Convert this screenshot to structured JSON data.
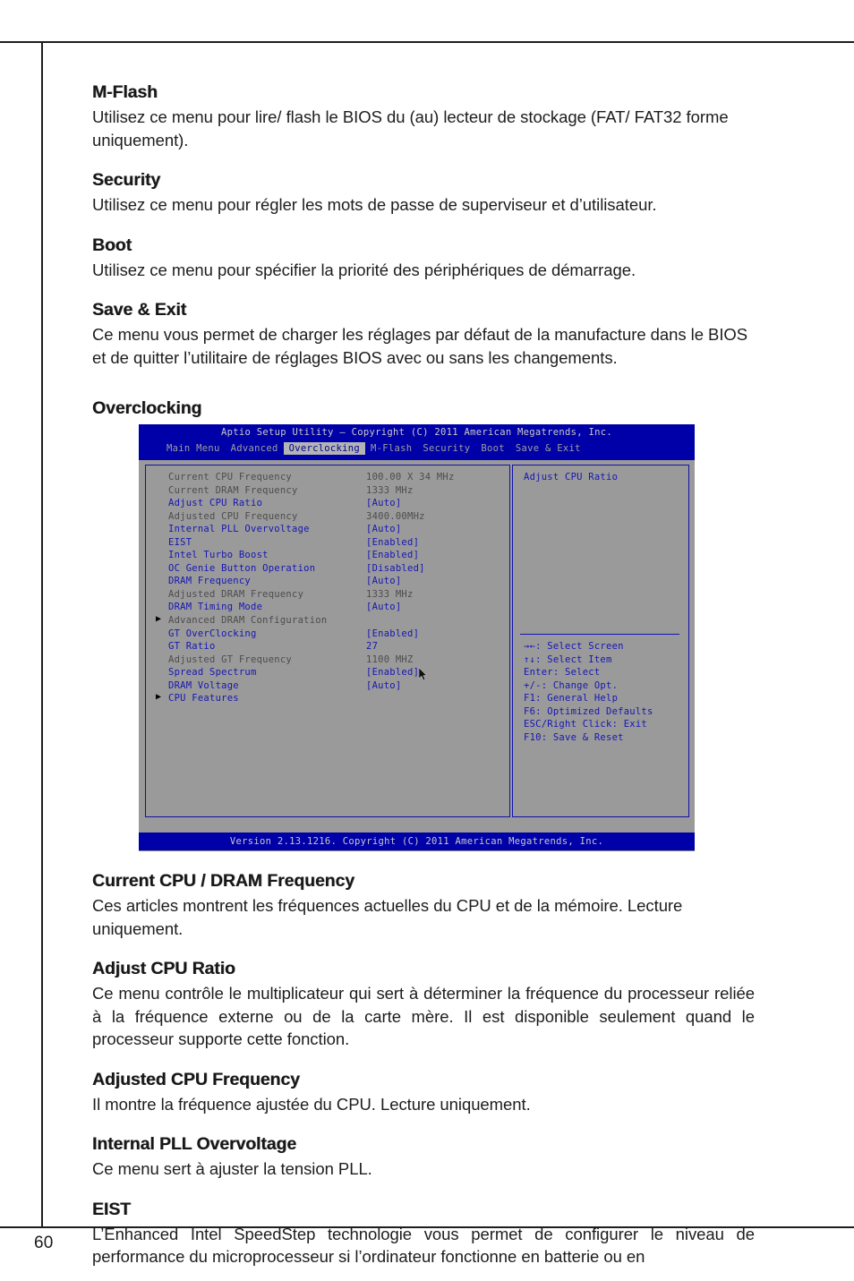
{
  "page": {
    "number": "60"
  },
  "sections": [
    {
      "title": "M-Flash",
      "body": "Utilisez ce menu pour lire/ flash le BIOS du (au) lecteur de stockage (FAT/ FAT32 forme uniquement)."
    },
    {
      "title": "Security",
      "body": "Utilisez ce menu pour régler les mots de passe de superviseur et d’utilisateur."
    },
    {
      "title": "Boot",
      "body": "Utilisez ce menu pour spécifier la priorité des périphériques de démarrage."
    },
    {
      "title": "Save & Exit",
      "body": "Ce menu vous permet de charger les réglages par défaut de la manufacture dans le BIOS et de quitter l’utilitaire de réglages BIOS avec ou sans les changements."
    }
  ],
  "overclocking_heading": "Overclocking",
  "bios": {
    "title": "Aptio Setup Utility – Copyright (C) 2011 American Megatrends, Inc.",
    "menu": [
      {
        "label": "Main Menu",
        "active": false
      },
      {
        "label": "Advanced",
        "active": false
      },
      {
        "label": "Overclocking",
        "active": true
      },
      {
        "label": "M-Flash",
        "active": false
      },
      {
        "label": "Security",
        "active": false
      },
      {
        "label": "Boot",
        "active": false
      },
      {
        "label": "Save & Exit",
        "active": false
      }
    ],
    "rows": [
      {
        "label": "Current CPU Frequency",
        "value": "100.00 X 34 MHz",
        "style": "grey",
        "arrow": ""
      },
      {
        "label": "Current DRAM Frequency",
        "value": "1333 MHz",
        "style": "grey",
        "arrow": ""
      },
      {
        "label": "Adjust CPU Ratio",
        "value": "[Auto]",
        "style": "blue",
        "arrow": ""
      },
      {
        "label": "Adjusted CPU Frequency",
        "value": "3400.00MHz",
        "style": "grey",
        "arrow": ""
      },
      {
        "label": "Internal PLL Overvoltage",
        "value": "[Auto]",
        "style": "blue",
        "arrow": ""
      },
      {
        "label": "EIST",
        "value": "[Enabled]",
        "style": "blue",
        "arrow": ""
      },
      {
        "label": "Intel Turbo Boost",
        "value": "[Enabled]",
        "style": "blue",
        "arrow": ""
      },
      {
        "label": "OC Genie Button Operation",
        "value": "[Disabled]",
        "style": "blue",
        "arrow": ""
      },
      {
        "label": "DRAM Frequency",
        "value": "[Auto]",
        "style": "blue",
        "arrow": ""
      },
      {
        "label": "Adjusted DRAM Frequency",
        "value": "1333 MHz",
        "style": "grey",
        "arrow": ""
      },
      {
        "label": "DRAM Timing Mode",
        "value": "[Auto]",
        "style": "blue",
        "arrow": ""
      },
      {
        "label": "Advanced DRAM Configuration",
        "value": "",
        "style": "grey",
        "arrow": "▶"
      },
      {
        "label": "GT OverClocking",
        "value": "[Enabled]",
        "style": "blue",
        "arrow": ""
      },
      {
        "label": "GT Ratio",
        "value": "27",
        "style": "blue",
        "arrow": ""
      },
      {
        "label": "Adjusted GT Frequency",
        "value": "1100 MHZ",
        "style": "grey",
        "arrow": ""
      },
      {
        "label": "Spread Spectrum",
        "value": "[Enabled]",
        "style": "blue",
        "arrow": ""
      },
      {
        "label": "DRAM Voltage",
        "value": "[Auto]",
        "style": "blue",
        "arrow": ""
      },
      {
        "label": "CPU Features",
        "value": "",
        "style": "blue",
        "arrow": "▶"
      }
    ],
    "help": {
      "title": "Adjust CPU Ratio",
      "keys": [
        "→←: Select Screen",
        "↑↓: Select Item",
        "Enter: Select",
        "+/-: Change Opt.",
        "F1: General Help",
        "F6: Optimized Defaults",
        "ESC/Right Click: Exit",
        "F10: Save & Reset"
      ]
    },
    "footer": "Version 2.13.1216. Copyright (C) 2011 American Megatrends, Inc.",
    "colors": {
      "header_blue": "#0000a8",
      "body_grey": "#9a9a9a",
      "text_blue": "#1616b4",
      "text_grey": "#4d4d4d",
      "active_tab_bg": "#b4b4b4"
    }
  },
  "sections_after": [
    {
      "title": "Current CPU / DRAM Frequency",
      "body": "Ces articles montrent les fréquences actuelles du CPU et de la mémoire. Lecture uniquement."
    },
    {
      "title": "Adjust CPU Ratio",
      "body": "Ce menu contrôle le multiplicateur qui sert à déterminer la fréquence du processeur reliée à la fréquence externe ou de la carte mère. Il est disponible seulement quand le processeur supporte cette fonction."
    },
    {
      "title": "Adjusted CPU Frequency",
      "body": "Il montre la fréquence ajustée du CPU. Lecture uniquement."
    },
    {
      "title": "Internal PLL Overvoltage",
      "body": "Ce menu sert à ajuster la tension PLL."
    },
    {
      "title": "EIST",
      "body": "L’Enhanced Intel SpeedStep technologie vous permet de configurer le niveau de performance du microprocesseur si l’ordinateur fonctionne en batterie ou en"
    }
  ]
}
